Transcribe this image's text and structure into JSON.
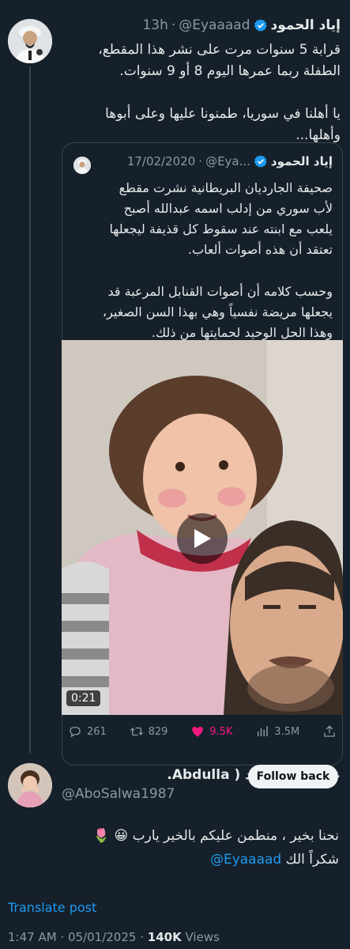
{
  "main_tweet": {
    "author_name": "إياد الحمود",
    "handle": "@Eyaaaad",
    "time": "13h",
    "text_lines": [
      "قرابة 5 سنوات مرت على نشر هذا المقطع،",
      "الطفلة ربما عمرها اليوم 8 أو 9 سنوات.",
      "",
      "يا أهلنا في سوريا، طمنونا عليها وعلى أبوها",
      "وأهلها..."
    ]
  },
  "quoted_tweet": {
    "author_name": "إياد الحمود",
    "handle": "@Eya...",
    "date": "17/02/2020",
    "text_lines": [
      "صحيفة الجارديان البريطانية نشرت مقطع",
      "لأب سوري من إدلب اسمه عبدالله أصبح",
      "يلعب مع ابنته عند سقوط كل قذيفة ليجعلها",
      "تعتقد أن هذه أصوات ألعاب.",
      "",
      "وحسب كلامه أن أصوات القنابل المرعبة قد",
      "يجعلها مريضة نفسياً وهي بهذا السن الصغير،",
      "وهذا الحل الوحيد لحمايتها من ذلك."
    ],
    "video_duration": "0:21"
  },
  "actions": {
    "replies": "261",
    "reposts": "829",
    "likes": "9.5K",
    "views": "3.5M"
  },
  "reply": {
    "author_name": "عبدالله المحمد ( Abdulla...",
    "handle": "@AboSalwa1987",
    "follow_label": "Follow back",
    "text_line1": "نحنا بخير ، منطمن عليكم بالخير يارب 😀 🌷",
    "text_line2_prefix": "شكراً الك ",
    "mention": "@Eyaaaad",
    "translate_label": "Translate post",
    "time": "1:47 AM",
    "date": "05/01/2025",
    "views_count": "140K",
    "views_label": "Views"
  },
  "colors": {
    "background": "#15202b",
    "accent": "#1d9bf0",
    "like": "#f91880",
    "muted": "#8b98a5"
  }
}
